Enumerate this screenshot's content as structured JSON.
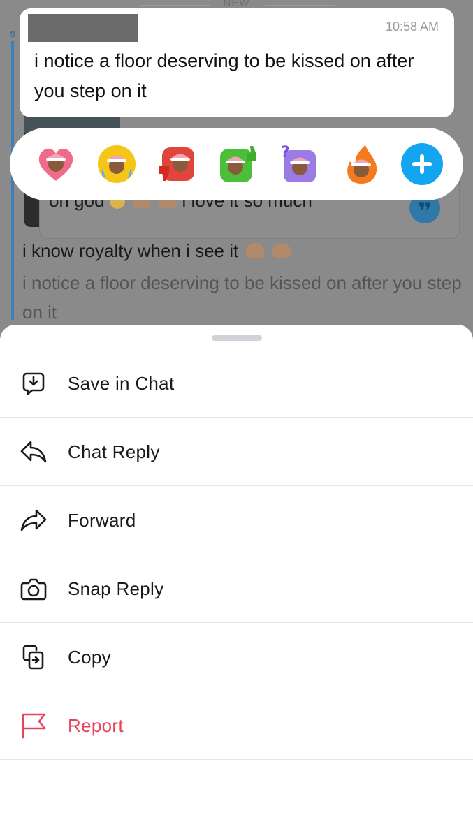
{
  "background_chat": {
    "new_divider_label": "NEW",
    "sender_initial": "s",
    "quoted_message": "on god",
    "quoted_message_tail": "i love it so much",
    "message_main": "i know royalty when i see it",
    "message_faded": "i notice a floor deserving to be kissed on after you step on it"
  },
  "focused_message": {
    "time": "10:58 AM",
    "text": "i notice a floor deserving to be kissed on after you step on it"
  },
  "reactions": [
    {
      "name": "heart-bitmoji-icon",
      "color": "#f06a8a"
    },
    {
      "name": "crying-laughing-bitmoji-icon",
      "color": "#f5c518"
    },
    {
      "name": "thumbs-down-bitmoji-icon",
      "color": "#e0443a"
    },
    {
      "name": "thumbs-up-bitmoji-icon",
      "color": "#4cbf3a"
    },
    {
      "name": "question-bitmoji-icon",
      "color": "#9b7be6"
    },
    {
      "name": "fire-bitmoji-icon",
      "color": "#f47a1f"
    }
  ],
  "add_reaction_icon": "plus-icon",
  "menu": {
    "items": [
      {
        "label": "Save in Chat",
        "icon": "save-icon"
      },
      {
        "label": "Chat Reply",
        "icon": "reply-icon"
      },
      {
        "label": "Forward",
        "icon": "forward-icon"
      },
      {
        "label": "Snap Reply",
        "icon": "camera-icon"
      },
      {
        "label": "Copy",
        "icon": "copy-icon"
      },
      {
        "label": "Report",
        "icon": "flag-icon"
      }
    ]
  },
  "colors": {
    "accent_blue": "#14a5f0",
    "danger": "#e8435a",
    "overlay": "#8a8a8a"
  }
}
